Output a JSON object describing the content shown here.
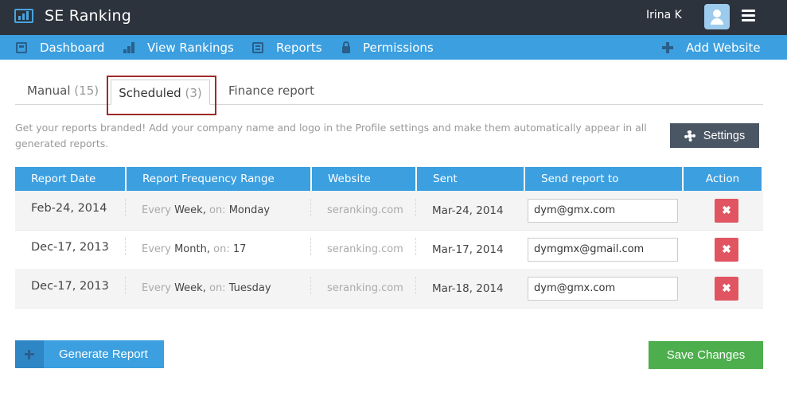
{
  "app": {
    "name": "SE Ranking"
  },
  "user": {
    "name": "Irina K"
  },
  "nav": {
    "dashboard": "Dashboard",
    "view_rankings": "View Rankings",
    "reports": "Reports",
    "permissions": "Permissions",
    "add_website": "Add Website"
  },
  "tabs": {
    "manual": {
      "label": "Manual",
      "count": "(15)"
    },
    "scheduled": {
      "label": "Scheduled",
      "count": "(3)"
    },
    "finance": {
      "label": "Finance report"
    }
  },
  "notice": "Get your reports branded! Add your company name and logo in the Profile settings and make them automatically appear in all generated reports.",
  "settings_label": "Settings",
  "table": {
    "headers": {
      "date": "Report Date",
      "range": "Report Frequency Range",
      "website": "Website",
      "sent": "Sent",
      "send_to": "Send report to",
      "action": "Action"
    },
    "rows": [
      {
        "date": "Feb-24, 2014",
        "every": "Every",
        "period": "Week,",
        "on": "on:",
        "day": "Monday",
        "website": "seranking.com",
        "sent": "Mar-24, 2014",
        "email": "dym@gmx.com"
      },
      {
        "date": "Dec-17, 2013",
        "every": "Every",
        "period": "Month,",
        "on": "on:",
        "day": "17",
        "website": "seranking.com",
        "sent": "Mar-17, 2014",
        "email": "dymgmx@gmail.com"
      },
      {
        "date": "Dec-17, 2013",
        "every": "Every",
        "period": "Week,",
        "on": "on:",
        "day": "Tuesday",
        "website": "seranking.com",
        "sent": "Mar-18, 2014",
        "email": "dym@gmx.com"
      }
    ]
  },
  "buttons": {
    "generate": "Generate Report",
    "save": "Save Changes",
    "delete_glyph": "✖"
  },
  "colors": {
    "topbar": "#2c333c",
    "accent": "#3b9fe0",
    "delete": "#e05561",
    "save": "#4cae4c",
    "highlight": "#9e2a2a"
  }
}
